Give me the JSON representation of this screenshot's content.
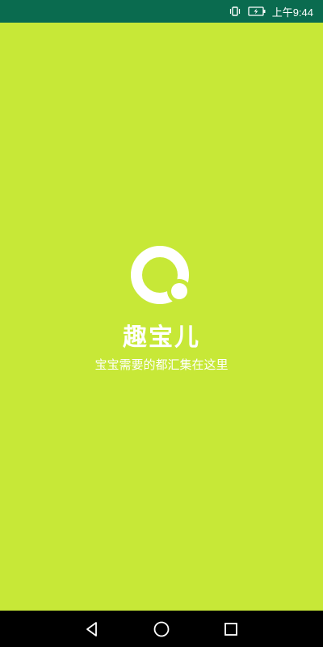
{
  "status_bar": {
    "time": "上午9:44",
    "icons": [
      "vibrate-icon",
      "battery-charging-icon"
    ]
  },
  "splash": {
    "logo_icon": "q-logo-icon",
    "app_name": "趣宝儿",
    "tagline": "宝宝需要的都汇集在这里",
    "background_color": "#c7e837"
  },
  "nav_bar": {
    "buttons": [
      "back-icon",
      "home-icon",
      "recents-icon"
    ]
  },
  "colors": {
    "status_bar": "#0a6b4f",
    "nav_bar": "#000000",
    "text": "#ffffff"
  }
}
